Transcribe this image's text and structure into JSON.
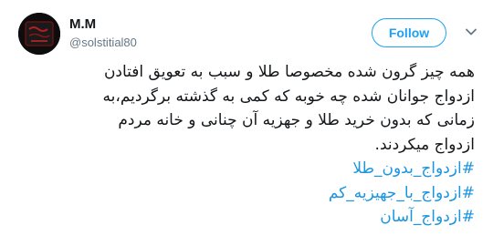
{
  "header": {
    "display_name": "M.M",
    "handle": "@solstitial80",
    "follow_label": "Follow",
    "avatar_icon": "avatar-icon",
    "more_icon": "chevron-down-icon"
  },
  "tweet": {
    "lines": [
      "همه چیز گرون شده مخصوصا طلا و سبب به تعویق افتادن",
      "ازدواج جوانان شده چه خوبه که کمی به گذشته برگردیم،به",
      "زمانی که بدون خرید طلا و جهزیه آن چنانی و خانه مردم",
      "ازدواج میکردند."
    ],
    "hashtags": [
      "#ازدواج_بدون_طلا",
      "#ازدواج_با_جهیزیه_کم",
      "#ازدواج_آسان"
    ]
  },
  "colors": {
    "accent": "#1da1f2",
    "hashtag": "#1b95e0",
    "text": "#14171a",
    "muted": "#657786"
  }
}
